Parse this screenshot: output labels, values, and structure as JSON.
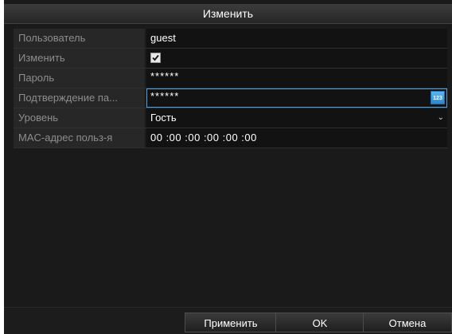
{
  "dialog": {
    "title": "Изменить"
  },
  "fields": [
    {
      "label": "Пользователь",
      "value": "guest"
    },
    {
      "label": "Изменить",
      "checked": true
    },
    {
      "label": "Пароль",
      "value": "******"
    },
    {
      "label": "Подтверждение па...",
      "value": "******",
      "keyboard_icon_text": "123"
    },
    {
      "label": "Уровень",
      "value": "Гость"
    },
    {
      "label": "MAC-адрес польз-я",
      "value": "00 :00 :00 :00 :00 :00"
    }
  ],
  "buttons": {
    "apply": "Применить",
    "ok": "OK",
    "cancel": "Отмена"
  },
  "colors": {
    "focus_border": "#4aa3e8",
    "background": "#1a1a1a",
    "label_text": "#8d8d8d"
  }
}
